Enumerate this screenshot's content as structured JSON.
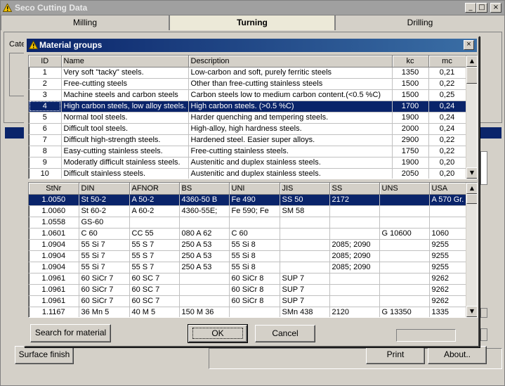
{
  "app": {
    "title": "Seco Cutting Data",
    "window_buttons": {
      "minimize": "_",
      "maximize": "□",
      "close": "×"
    },
    "tabs": [
      {
        "label": "Milling",
        "active": false
      },
      {
        "label": "Turning",
        "active": true
      },
      {
        "label": "Drilling",
        "active": false
      }
    ],
    "category_label": "Cate",
    "surface_finish_button": "Surface finish",
    "print_button": "Print",
    "about_button": "About.."
  },
  "dialog": {
    "title": "Material groups",
    "close_label": "×",
    "groups_table": {
      "columns": [
        "ID",
        "Name",
        "Description",
        "kc",
        "mc"
      ],
      "rows": [
        [
          "1",
          "Very soft \"tacky\" steels.",
          "Low-carbon and soft, purely ferritic steels",
          "1350",
          "0,21"
        ],
        [
          "2",
          "Free-cutting steels",
          "Other than free-cutting stainless steels",
          "1500",
          "0,22"
        ],
        [
          "3",
          "Machine steels and carbon steels",
          "Carbon steels low to medium carbon content.(<0.5 %C)",
          "1500",
          "0,25"
        ],
        [
          "4",
          "High carbon steels, low alloy steels.",
          "High carbon steels. (>0.5 %C)",
          "1700",
          "0,24"
        ],
        [
          "5",
          "Normal tool steels.",
          "Harder quenching and tempering steels.",
          "1900",
          "0,24"
        ],
        [
          "6",
          "Difficult tool steels.",
          "High-alloy, high hardness steels.",
          "2000",
          "0,24"
        ],
        [
          "7",
          "Difficult high-strength steels.",
          "Hardened steel. Easier super alloys.",
          "2900",
          "0,22"
        ],
        [
          "8",
          "Easy-cutting stainless steels.",
          "Free-cutting stainless steels.",
          "1750",
          "0,22"
        ],
        [
          "9",
          "Moderatly difficult stainless steels.",
          "Austenitic and duplex stainless steels.",
          "1900",
          "0,20"
        ],
        [
          "10",
          "Difficult stainless steels.",
          "Austenitic and duplex stainless steels.",
          "2050",
          "0,20"
        ]
      ],
      "selected_index": 3
    },
    "materials_table": {
      "columns": [
        "StNr",
        "DIN",
        "AFNOR",
        "BS",
        "UNI",
        "JIS",
        "SS",
        "UNS",
        "USA"
      ],
      "rows": [
        [
          "1.0050",
          "St 50-2",
          "A 50-2",
          "4360-50 B",
          "Fe 490",
          "SS 50",
          "2172",
          "",
          "A 570 Gr."
        ],
        [
          "1.0060",
          "St 60-2",
          "A 60-2",
          "4360-55E;",
          "Fe 590; Fe",
          "SM 58",
          "",
          "",
          ""
        ],
        [
          "1.0558",
          "GS-60",
          "",
          "",
          "",
          "",
          "",
          "",
          ""
        ],
        [
          "1.0601",
          "C 60",
          "CC 55",
          "080 A 62",
          "C 60",
          "",
          "",
          "G 10600",
          "1060"
        ],
        [
          "1.0904",
          "55 Si 7",
          "55 S 7",
          "250 A 53",
          "55 Si 8",
          "",
          "2085; 2090",
          "",
          "9255"
        ],
        [
          "1.0904",
          "55 Si 7",
          "55 S 7",
          "250 A 53",
          "55 Si 8",
          "",
          "2085; 2090",
          "",
          "9255"
        ],
        [
          "1.0904",
          "55 Si 7",
          "55 S 7",
          "250 A 53",
          "55 Si 8",
          "",
          "2085; 2090",
          "",
          "9255"
        ],
        [
          "1.0961",
          "60 SiCr 7",
          "60 SC 7",
          "",
          "60 SiCr 8",
          "SUP 7",
          "",
          "",
          "9262"
        ],
        [
          "1.0961",
          "60 SiCr 7",
          "60 SC 7",
          "",
          "60 SiCr 8",
          "SUP 7",
          "",
          "",
          "9262"
        ],
        [
          "1.0961",
          "60 SiCr 7",
          "60 SC 7",
          "",
          "60 SiCr 8",
          "SUP 7",
          "",
          "",
          "9262"
        ],
        [
          "1.1167",
          "36 Mn 5",
          "40 M 5",
          "150 M 36",
          "",
          "SMn 438",
          "2120",
          "G 13350",
          "1335"
        ]
      ],
      "selected_index": 0
    },
    "search_button": "Search for material",
    "ok_button": "OK",
    "cancel_button": "Cancel"
  },
  "colors": {
    "selection": "#0a246a",
    "face": "#d4d0c8"
  }
}
